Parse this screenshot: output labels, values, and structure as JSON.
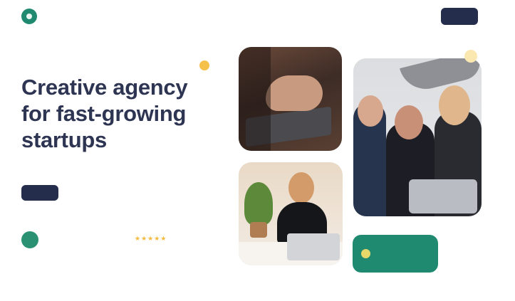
{
  "brand": {
    "name": "",
    "accent": "#1f8a70",
    "navy": "#252d4d",
    "star_color": "#f6b93b"
  },
  "header": {
    "nav": [
      "",
      "",
      "",
      ""
    ],
    "login_label": "",
    "cta_label": ""
  },
  "hero": {
    "title": "Creative agency for fast-growing startups",
    "description": "",
    "cta_label": "",
    "note": ""
  },
  "trust": {
    "text": "",
    "rating_label": "",
    "stars": 5
  },
  "stat_card": {
    "text": ""
  }
}
